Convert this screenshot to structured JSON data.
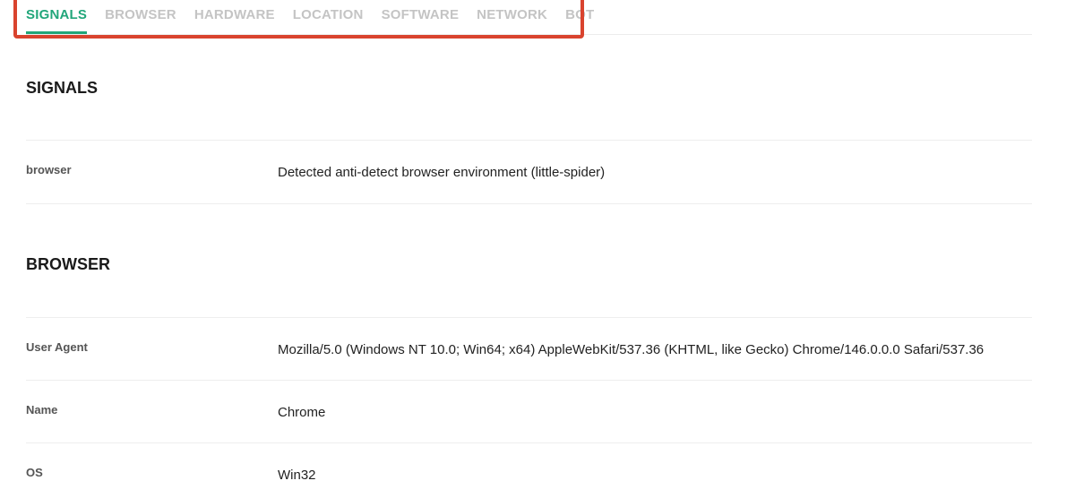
{
  "tabs": [
    {
      "label": "SIGNALS",
      "active": true
    },
    {
      "label": "BROWSER",
      "active": false
    },
    {
      "label": "HARDWARE",
      "active": false
    },
    {
      "label": "LOCATION",
      "active": false
    },
    {
      "label": "SOFTWARE",
      "active": false
    },
    {
      "label": "NETWORK",
      "active": false
    },
    {
      "label": "BOT",
      "active": false
    }
  ],
  "colors": {
    "accent": "#21a67a",
    "inactive_tab": "#c4c4c4",
    "highlight": "#d9432e"
  },
  "signals": {
    "title": "SIGNALS",
    "rows": [
      {
        "label": "browser",
        "value": "Detected anti-detect browser environment (little-spider)"
      }
    ]
  },
  "browser": {
    "title": "BROWSER",
    "rows": [
      {
        "label": "User Agent",
        "value": "Mozilla/5.0 (Windows NT 10.0; Win64; x64) AppleWebKit/537.36 (KHTML, like Gecko) Chrome/146.0.0.0 Safari/537.36"
      },
      {
        "label": "Name",
        "value": "Chrome"
      },
      {
        "label": "OS",
        "value": "Win32"
      }
    ]
  }
}
